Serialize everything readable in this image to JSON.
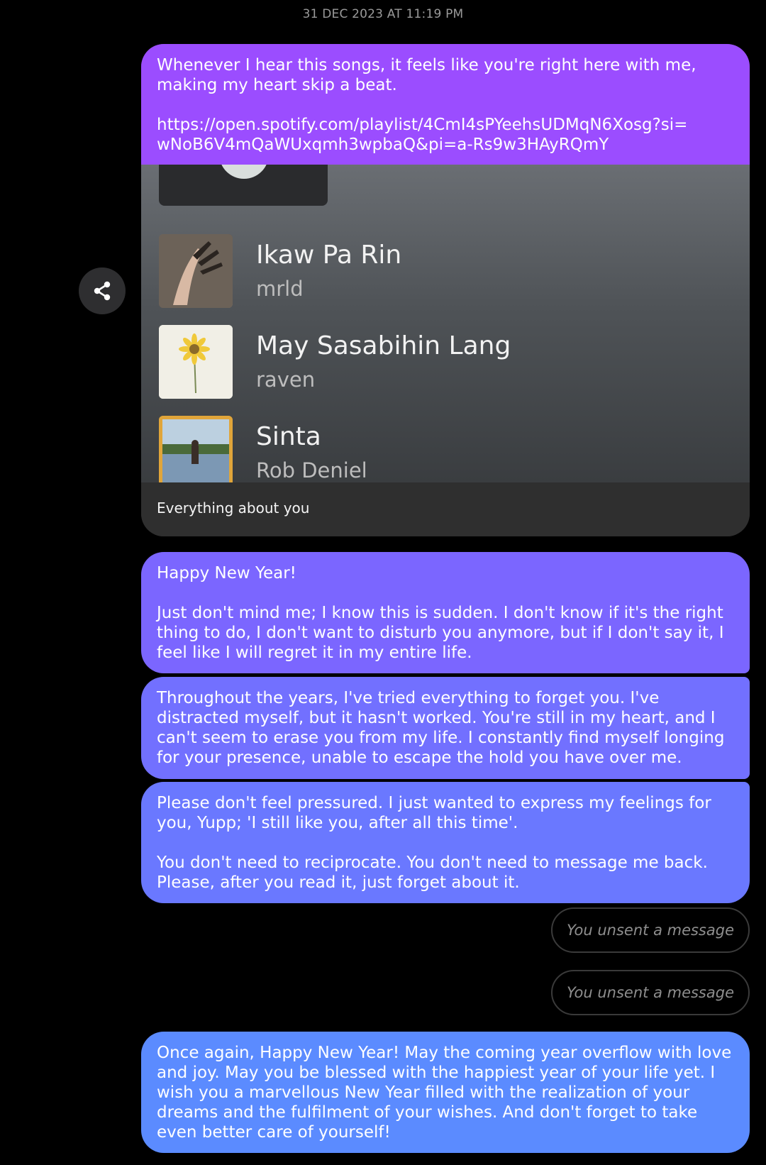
{
  "thread": {
    "timestamp": "31 DEC 2023 AT 11:19 PM"
  },
  "share_button": {
    "icon": "share-icon"
  },
  "link_message": {
    "text": "Whenever I hear this songs, it feels like you're right here with me, making my heart skip a beat.\n\nhttps://open.spotify.com/playlist/4CmI4sPYeehsUDMqN6Xosg?si=\nwNoB6V4mQaWUxqmh3wpbaQ&pi=a-Rs9w3HAyRQmY",
    "color": "#9b4dff",
    "preview": {
      "tracks": [
        {
          "title": "Ikaw Pa Rin",
          "artist": "mrld"
        },
        {
          "title": "May Sasabihin Lang",
          "artist": "raven"
        },
        {
          "title": "Sinta",
          "artist": "Rob Deniel"
        }
      ],
      "title": "Everything about you"
    }
  },
  "messages": [
    {
      "text": "Happy New Year!\n\nJust don't mind me; I know this is sudden. I don't know if it's the right thing to do, I don't want to disturb you anymore, but if I don't say it, I feel like I will regret it in my entire life.",
      "color": "#7b66ff"
    },
    {
      "text": "Throughout the years, I've tried everything to forget you. I've distracted myself, but it hasn't worked. You're still in my heart, and I can't seem to erase you from my life. I constantly find myself longing for your presence, unable to escape the hold you have over me.",
      "color": "#7270ff"
    },
    {
      "text": "Please don't feel pressured. I just wanted to express my feelings for you, Yupp; 'I still like you, after all this time'.\n\nYou don't need to reciprocate. You don't need to message me back. Please, after you read it, just forget about it.",
      "color": "#6a78ff"
    },
    {
      "text": "Once again, Happy New Year! May the coming year overflow with love and joy. May you be blessed with the happiest year of your life yet. I wish you a marvellous New Year filled with the realization of your dreams and the fulfilment of your wishes. And don't forget to take even better care of yourself!",
      "color": "#5b8bff"
    }
  ],
  "unsent": [
    {
      "text": "You unsent a message"
    },
    {
      "text": "You unsent a message"
    }
  ]
}
